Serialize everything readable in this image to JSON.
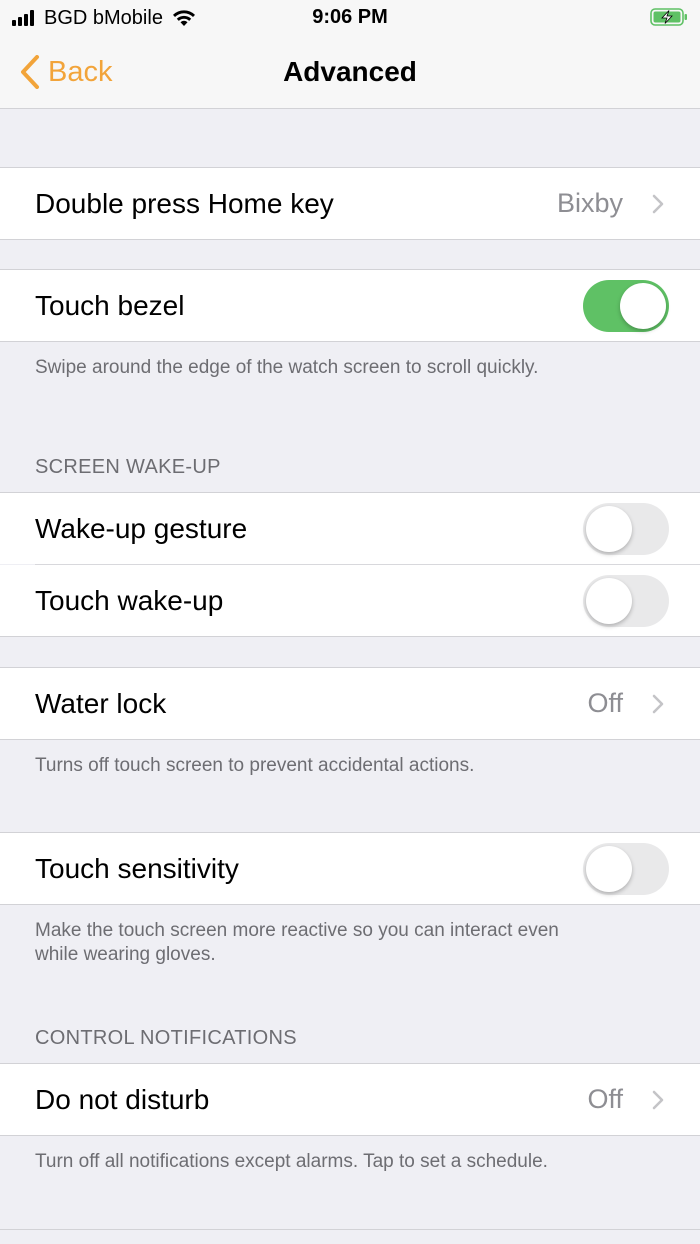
{
  "status": {
    "carrier": "BGD bMobile",
    "time": "9:06 PM"
  },
  "nav": {
    "back_label": "Back",
    "title": "Advanced"
  },
  "rows": {
    "double_press": {
      "label": "Double press Home key",
      "value": "Bixby"
    },
    "touch_bezel": {
      "label": "Touch bezel",
      "on": true
    },
    "touch_bezel_footer": "Swipe around the edge of the watch screen to scroll quickly.",
    "screen_wakeup_header": "SCREEN WAKE-UP",
    "wakeup_gesture": {
      "label": "Wake-up gesture",
      "on": false
    },
    "touch_wakeup": {
      "label": "Touch wake-up",
      "on": false
    },
    "water_lock": {
      "label": "Water lock",
      "value": "Off"
    },
    "water_lock_footer": "Turns off touch screen to prevent accidental actions.",
    "touch_sensitivity": {
      "label": "Touch sensitivity",
      "on": false
    },
    "touch_sensitivity_footer_1": "Make the touch screen more reactive so you can interact even",
    "touch_sensitivity_footer_2": "while wearing gloves.",
    "control_notifications_header": "CONTROL NOTIFICATIONS",
    "do_not_disturb": {
      "label": "Do not disturb",
      "value": "Off"
    },
    "do_not_disturb_footer": "Turn off all notifications except alarms. Tap to set a schedule."
  },
  "colors": {
    "accent": "#f2a43a",
    "toggle_on": "#5fc165",
    "toggle_off": "#e9e9ea",
    "background": "#efeff4"
  }
}
